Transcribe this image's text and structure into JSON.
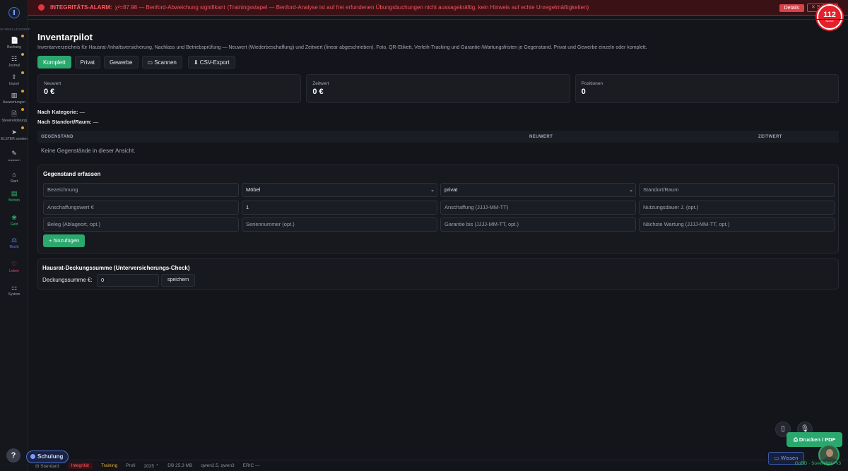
{
  "alarm": {
    "title": "INTEGRITÄTS-ALARM:",
    "stat": "χ²=87.98 — Benford-Abweichung signifikant",
    "text": "(Trainingsstapel — Benford-Analyse ist auf frei erfundenen Übungsbuchungen nicht aussagekräftig, kein Hinweis auf echte Unregelmäßigkeiten)",
    "details": "Details",
    "close": "✕ Sc"
  },
  "notruf": {
    "number": "112",
    "label": "Notruf"
  },
  "sidebar": {
    "section": "SCHNELLZUGRIFF",
    "items": [
      {
        "label": "Buchung",
        "icon": "📄"
      },
      {
        "label": "Journal",
        "icon": "☷"
      },
      {
        "label": "Import",
        "icon": "⇪"
      },
      {
        "label": "Auswertungen",
        "icon": "▥"
      },
      {
        "label": "Steuererklärung",
        "icon": "🗎"
      },
      {
        "label": "ELSTER senden",
        "icon": "➤"
      },
      {
        "label": "anpassen",
        "icon": "✎"
      },
      {
        "label": "Start",
        "icon": "⌂"
      },
      {
        "label": "Betrieb",
        "icon": "▤"
      },
      {
        "label": "Geld",
        "icon": "❀"
      },
      {
        "label": "Recht",
        "icon": "⚖"
      },
      {
        "label": "Leben",
        "icon": "♡"
      },
      {
        "label": "System",
        "icon": "⚏"
      }
    ],
    "help": "?",
    "schulung": "Schulung"
  },
  "page": {
    "title": "Inventarpilot",
    "subtitle": "Inventarverzeichnis für Hausrat-/Inhaltsversicherung, Nachlass und Betriebsprüfung — Neuwert (Wiederbeschaffung) und Zeitwert (linear abgeschrieben). Foto, QR-Etikett, Verleih-Tracking und Garantie-/Wartungsfristen je Gegenstand. Privat und Gewerbe einzeln oder komplett."
  },
  "tabs": [
    "Komplett",
    "Privat",
    "Gewerbe"
  ],
  "actions": {
    "scan": "▭ Scannen",
    "csv": "⬇ CSV-Export"
  },
  "cards": [
    {
      "label": "Neuwert",
      "value": "0 €"
    },
    {
      "label": "Zeitwert",
      "value": "0 €"
    },
    {
      "label": "Positionen",
      "value": "0"
    }
  ],
  "aggregates": {
    "by_category_label": "Nach Kategorie:",
    "by_category_value": " —",
    "by_location_label": "Nach Standort/Raum:",
    "by_location_value": " —"
  },
  "table": {
    "columns": [
      "GEGENSTAND",
      "NEUWERT",
      "ZEITWERT"
    ],
    "empty": "Keine Gegenstände in dieser Ansicht."
  },
  "form": {
    "title": "Gegenstand erfassen",
    "name_ph": "Bezeichnung",
    "category": "Möbel",
    "scope": "privat",
    "location_ph": "Standort/Raum",
    "cost_ph": "Anschaffungswert €",
    "qty": "1",
    "date_ph": "Anschaffung (JJJJ-MM-TT)",
    "life_ph": "Nutzungsdauer J. (opt.)",
    "receipt_ph": "Beleg (Ablageort, opt.)",
    "serial_ph": "Seriennummer (opt.)",
    "warranty_ph": "Garantie bis (JJJJ-MM-TT, opt.)",
    "service_ph": "Nächste Wartung (JJJJ-MM-TT, opt.)",
    "add": "+ hinzufügen"
  },
  "coverage": {
    "title": "Hausrat-Deckungssumme (Unterversicherungs-Check)",
    "label": "Deckungssumme €:",
    "value": "0",
    "save": "speichern"
  },
  "floating": {
    "print": "⎙ Drucken / PDF",
    "wissen": "▭ Wissen"
  },
  "status": {
    "standard": "⊟ Standard",
    "integrity": "Integrität",
    "training": "Training",
    "profi": "Profi",
    "year": "2025 ⌃",
    "db": "DB 25.3 MB",
    "models": "qwen2.5, qwen3",
    "eric": "ERIC —",
    "gobd": "GoBD · Sovereign · v3"
  }
}
